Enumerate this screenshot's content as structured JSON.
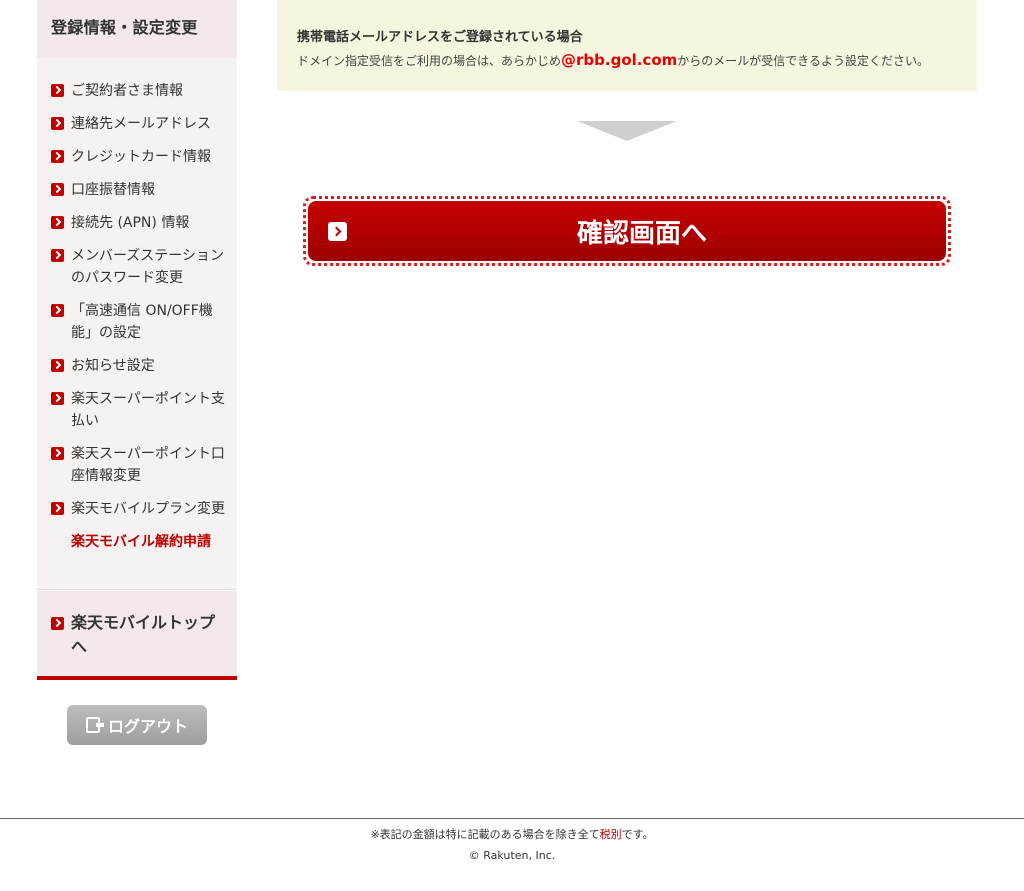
{
  "sidebar": {
    "heading": "登録情報・設定変更",
    "items": [
      {
        "label": "ご契約者さま情報"
      },
      {
        "label": "連絡先メールアドレス"
      },
      {
        "label": "クレジットカード情報"
      },
      {
        "label": "口座振替情報"
      },
      {
        "label": "接続先 (APN) 情報"
      },
      {
        "label": "メンバーズステーションのパスワード変更"
      },
      {
        "label": "「高速通信 ON/OFF機能」の設定"
      },
      {
        "label": "お知らせ設定"
      },
      {
        "label": "楽天スーパーポイント支払い"
      },
      {
        "label": "楽天スーパーポイント口座情報変更"
      },
      {
        "label": "楽天モバイルプラン変更"
      }
    ],
    "active_item": "楽天モバイル解約申請",
    "top_link": "楽天モバイルトップへ",
    "logout_label": "ログアウト"
  },
  "notice": {
    "title": "携帯電話メールアドレスをご登録されている場合",
    "text_before": "ドメイン指定受信をご利用の場合は、あらかじめ",
    "domain": "@rbb.gol.com",
    "text_after": "からのメールが受信できるよう設定ください。"
  },
  "main": {
    "confirm_label": "確認画面へ"
  },
  "footer": {
    "note_before": "※表記の金額は特に記載のある場合を除き全て",
    "note_red": "税別",
    "note_after": "です。",
    "copyright": "© Rakuten, Inc."
  },
  "colors": {
    "accent": "#bf0000",
    "notice_bg": "#f6f6e0",
    "sidebar_bg": "#f7f2f2"
  }
}
